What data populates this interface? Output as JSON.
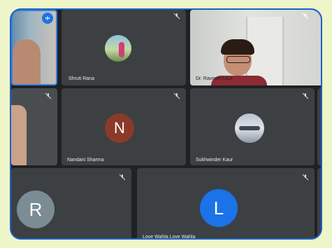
{
  "participants": {
    "p1": {
      "name": "Shruti Rana"
    },
    "p2": {
      "name": "Dr. Ravneet kaur"
    },
    "p3": {
      "name": "Nandani Sharma",
      "initial": "N"
    },
    "p4": {
      "name": "Sukhwinder Kaur"
    },
    "p5": {
      "name": "",
      "initial": "R"
    },
    "p6": {
      "name": "Love Wahla Love Wahla",
      "initial": "L"
    }
  },
  "colors": {
    "frame_bg": "#eef5c9",
    "border": "#1a63c8",
    "tile_bg": "#3c4043",
    "avatar_n": "#8b3a2a",
    "avatar_r": "#7b8c95",
    "avatar_l": "#1a73e8"
  }
}
